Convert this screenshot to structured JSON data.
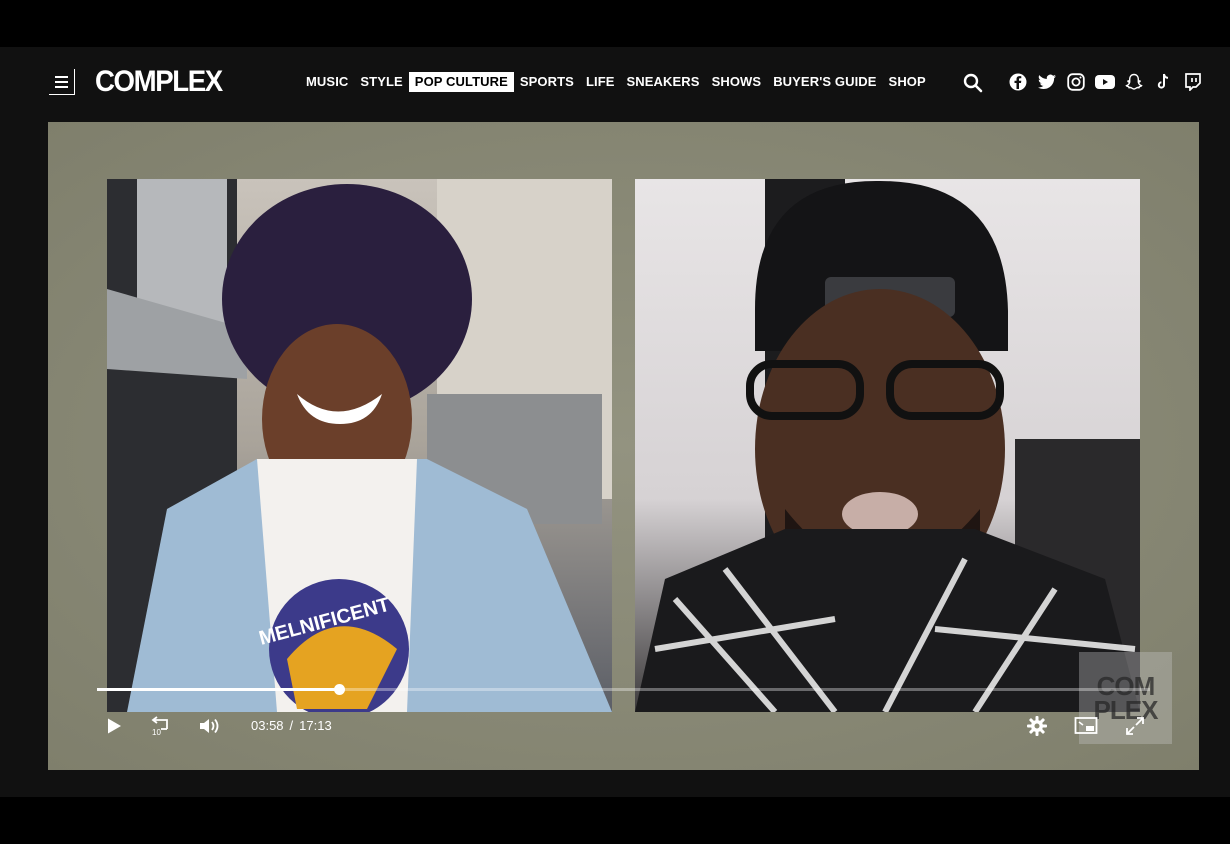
{
  "brand": {
    "logo": "COMPLEX"
  },
  "nav": [
    {
      "label": "MUSIC",
      "active": false
    },
    {
      "label": "STYLE",
      "active": false
    },
    {
      "label": "POP CULTURE",
      "active": true
    },
    {
      "label": "SPORTS",
      "active": false
    },
    {
      "label": "LIFE",
      "active": false
    },
    {
      "label": "SNEAKERS",
      "active": false
    },
    {
      "label": "SHOWS",
      "active": false
    },
    {
      "label": "BUYER'S GUIDE",
      "active": false
    },
    {
      "label": "SHOP",
      "active": false
    }
  ],
  "social_icons": [
    "facebook-icon",
    "twitter-icon",
    "instagram-icon",
    "youtube-icon",
    "snapchat-icon",
    "tiktok-icon",
    "twitch-icon"
  ],
  "video": {
    "current_time": "03:58",
    "separator": "/",
    "duration": "17:13",
    "progress_fraction": 0.23,
    "skip_seconds": "10",
    "watermark": "COM\nPLEX"
  },
  "colors": {
    "nav_active_bg": "#ffffff",
    "site_bg": "#111111",
    "video_frame": "#8a8a74"
  }
}
